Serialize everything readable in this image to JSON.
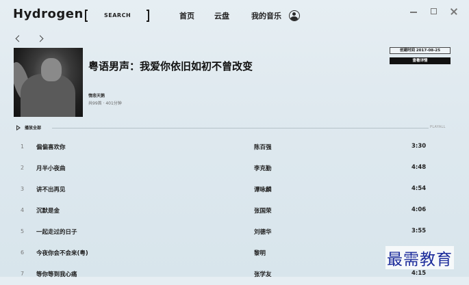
{
  "header": {
    "app_name": "Hydrogen",
    "search_label": "SEARCH",
    "nav": {
      "home": "首页",
      "cloud": "云盘",
      "my_music": "我的音乐"
    }
  },
  "album": {
    "title": "粤语男声：我爱你依旧如初不曾改变",
    "creator": "惰悲天鹅",
    "meta": "共99首 · 401分钟",
    "created_label": "创建时间 2017-08-25",
    "details_button": "查看详情"
  },
  "playall": {
    "label": "播放全部",
    "label_en": "PLAYALL"
  },
  "tracks": [
    {
      "index": "1",
      "title": "偏偏喜欢你",
      "artist": "陈百强",
      "duration": "3:30"
    },
    {
      "index": "2",
      "title": "月半小夜曲",
      "artist": "李克勤",
      "duration": "4:48"
    },
    {
      "index": "3",
      "title": "讲不出再见",
      "artist": "谭咏麟",
      "duration": "4:54"
    },
    {
      "index": "4",
      "title": "沉默是金",
      "artist": "张国荣",
      "duration": "4:06"
    },
    {
      "index": "5",
      "title": "一起走过的日子",
      "artist": "刘德华",
      "duration": "3:55"
    },
    {
      "index": "6",
      "title": "今夜你会不会来(粤)",
      "artist": "黎明",
      "duration": ""
    },
    {
      "index": "7",
      "title": "等你等到我心痛",
      "artist": "张学友",
      "duration": "4:15"
    }
  ],
  "watermark": "最需教育",
  "icons": {
    "back": "arrow-left-icon",
    "forward": "arrow-right-icon",
    "avatar": "user-avatar-icon",
    "minimize": "minimize-icon",
    "maximize": "maximize-icon",
    "close": "close-icon",
    "play": "play-icon"
  }
}
